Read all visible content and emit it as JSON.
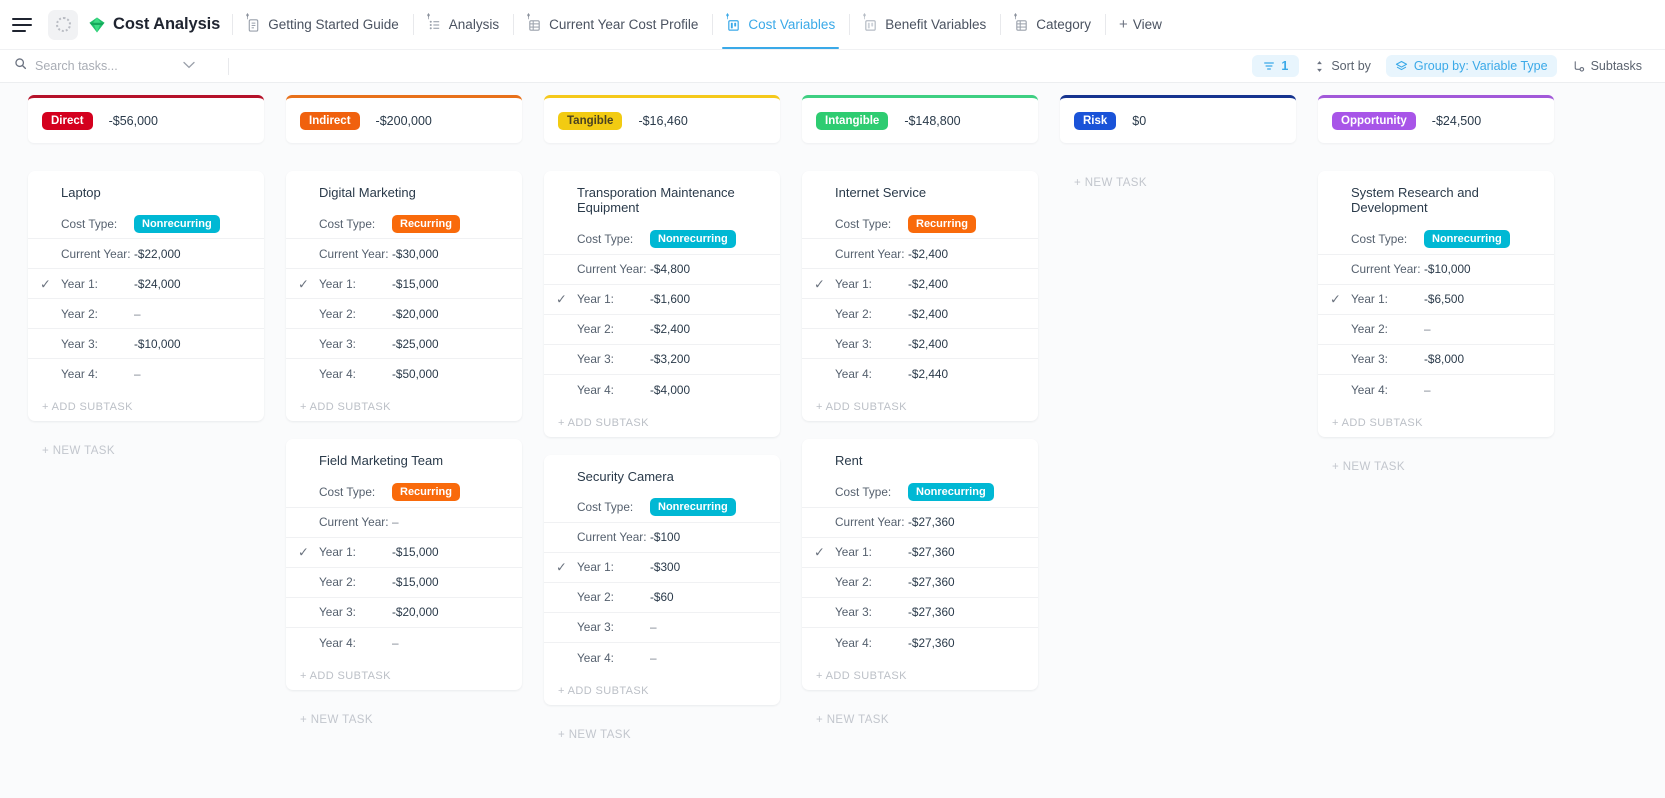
{
  "topbar": {
    "menu_icon": "hamburger-icon",
    "spinner_icon": "loading-spinner-icon",
    "brand_logo_icon": "money-diamond-logo-icon",
    "brand_title": "Cost Analysis",
    "tabs": [
      {
        "label": "Getting Started Guide",
        "icon": "doc-icon",
        "active": false
      },
      {
        "label": "Analysis",
        "icon": "list-icon",
        "active": false
      },
      {
        "label": "Current Year Cost Profile",
        "icon": "table-icon",
        "active": false
      },
      {
        "label": "Cost Variables",
        "icon": "board-icon",
        "active": true
      },
      {
        "label": "Benefit Variables",
        "icon": "board-icon",
        "active": false
      },
      {
        "label": "Category",
        "icon": "table-icon",
        "active": false
      }
    ],
    "view_button": {
      "label": "View",
      "icon": "plus-icon"
    }
  },
  "filterbar": {
    "search": {
      "placeholder": "Search tasks...",
      "value": "",
      "icon": "search-icon"
    },
    "search_chevron_icon": "chevron-down-icon",
    "filter_count": "1",
    "filter_icon": "filter-icon",
    "sort_label": "Sort by",
    "sort_icon": "sort-icon",
    "group_label": "Group by: Variable Type",
    "group_icon": "layers-icon",
    "subtasks_label": "Subtasks",
    "subtasks_icon": "subtask-icon"
  },
  "board": {
    "add_subtask_label": "+ ADD SUBTASK",
    "new_task_label": "+ NEW TASK",
    "row_labels": [
      "Cost Type:",
      "Current Year:",
      "Year 1:",
      "Year 2:",
      "Year 3:",
      "Year 4:"
    ],
    "columns": [
      {
        "badge": "Direct",
        "badge_color": "#d4001e",
        "accent": "#b5122a",
        "sum": "-$56,000",
        "cards": [
          {
            "title": "Laptop",
            "cost_type": "Nonrecurring",
            "current_year": "-$22,000",
            "year1": "-$24,000",
            "year2": "–",
            "year3": "-$10,000",
            "year4": "–",
            "checked_row": "year1"
          }
        ]
      },
      {
        "badge": "Indirect",
        "badge_color": "#f0610e",
        "accent": "#e8711a",
        "sum": "-$200,000",
        "cards": [
          {
            "title": "Digital Marketing",
            "cost_type": "Recurring",
            "current_year": "-$30,000",
            "year1": "-$15,000",
            "year2": "-$20,000",
            "year3": "-$25,000",
            "year4": "-$50,000",
            "checked_row": "year1"
          },
          {
            "title": "Field Marketing Team",
            "cost_type": "Recurring",
            "current_year": "–",
            "year1": "-$15,000",
            "year2": "-$15,000",
            "year3": "-$20,000",
            "year4": "–",
            "checked_row": "year1"
          }
        ]
      },
      {
        "badge": "Tangible",
        "badge_color": "#f2cb12",
        "accent": "#f5c91b",
        "sum": "-$16,460",
        "cards": [
          {
            "title": "Transporation Maintenance Equipment",
            "cost_type": "Nonrecurring",
            "current_year": "-$4,800",
            "year1": "-$1,600",
            "year2": "-$2,400",
            "year3": "-$3,200",
            "year4": "-$4,000",
            "checked_row": "year1"
          },
          {
            "title": "Security Camera",
            "cost_type": "Nonrecurring",
            "current_year": "-$100",
            "year1": "-$300",
            "year2": "-$60",
            "year3": "–",
            "year4": "–",
            "checked_row": "year1"
          }
        ]
      },
      {
        "badge": "Intangible",
        "badge_color": "#2ecc71",
        "accent": "#3ecf82",
        "sum": "-$148,800",
        "cards": [
          {
            "title": "Internet Service",
            "cost_type": "Recurring",
            "current_year": "-$2,400",
            "year1": "-$2,400",
            "year2": "-$2,400",
            "year3": "-$2,400",
            "year4": "-$2,440",
            "checked_row": "year1"
          },
          {
            "title": "Rent",
            "cost_type": "Nonrecurring",
            "current_year": "-$27,360",
            "year1": "-$27,360",
            "year2": "-$27,360",
            "year3": "-$27,360",
            "year4": "-$27,360",
            "checked_row": "year1"
          }
        ]
      },
      {
        "badge": "Risk",
        "badge_color": "#1a53d8",
        "accent": "#16348f",
        "sum": "$0",
        "cards": []
      },
      {
        "badge": "Opportunity",
        "badge_color": "#a855e8",
        "accent": "#a259d9",
        "sum": "-$24,500",
        "cards": [
          {
            "title": "System Research and Development",
            "cost_type": "Nonrecurring",
            "current_year": "-$10,000",
            "year1": "-$6,500",
            "year2": "–",
            "year3": "-$8,000",
            "year4": "–",
            "checked_row": "year1"
          }
        ]
      }
    ]
  }
}
